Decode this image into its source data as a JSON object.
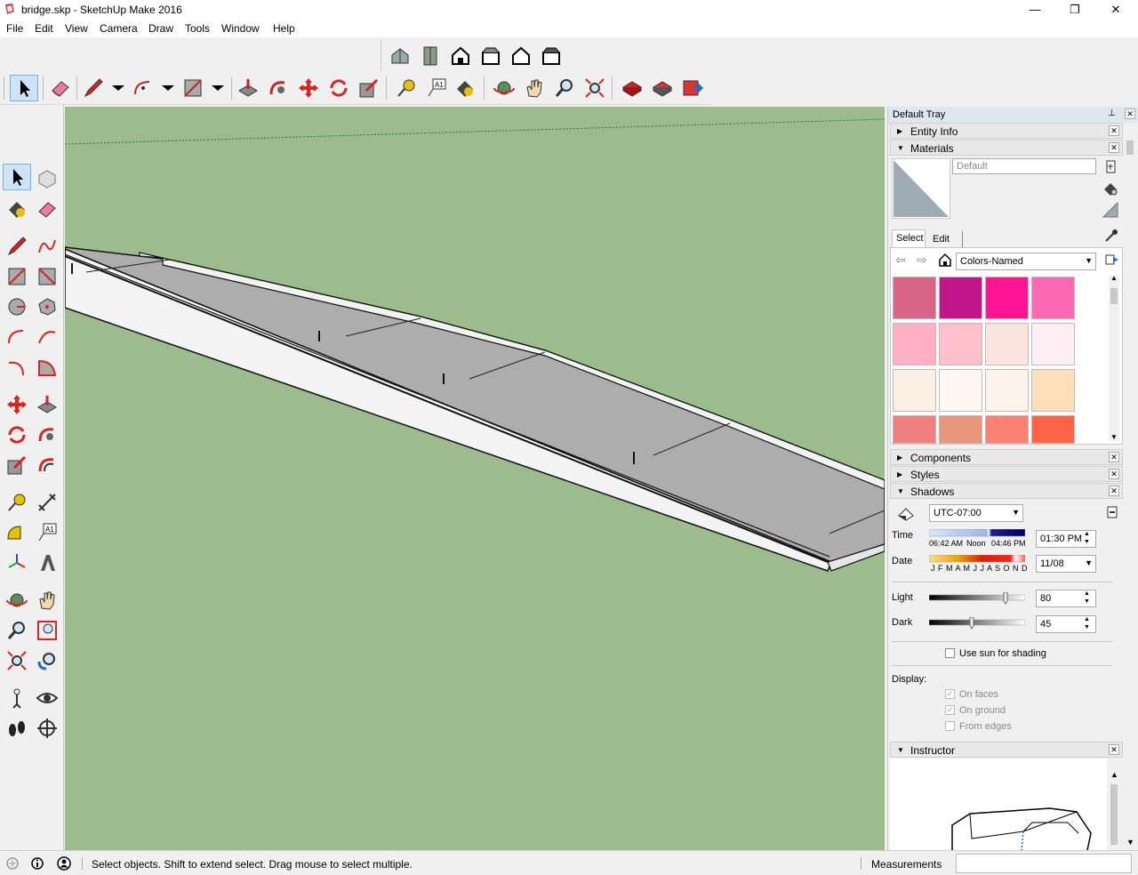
{
  "window": {
    "title": "bridge.skp - SketchUp Make 2016",
    "minimize": "—",
    "maximize": "❐",
    "close": "✕"
  },
  "menu": [
    "File",
    "Edit",
    "View",
    "Camera",
    "Draw",
    "Tools",
    "Window",
    "Help"
  ],
  "tray": {
    "title": "Default Tray",
    "entity_info": "Entity Info",
    "materials": {
      "header": "Materials",
      "name_placeholder": "Default",
      "tab_select": "Select",
      "tab_edit": "Edit",
      "library": "Colors-Named",
      "swatches": [
        "#d9668a",
        "#c0168a",
        "#ff1493",
        "#ff69b4",
        "#ffb0c4",
        "#ffc0cb",
        "#fde3de",
        "#fff0f5",
        "#fbefe3",
        "#fdf8f3",
        "#fdf3ec",
        "#ffdfb9",
        "#f08080",
        "#e9967a",
        "#fa8072",
        "#ff6347"
      ]
    },
    "components": "Components",
    "styles": "Styles",
    "shadows": {
      "header": "Shadows",
      "timezone": "UTC-07:00",
      "time_label": "Time",
      "time_sunrise": "06:42 AM",
      "time_noon": "Noon",
      "time_sunset": "04:46 PM",
      "time_value": "01:30 PM",
      "date_label": "Date",
      "months": "J F M A M J J A S O N D",
      "date_value": "11/08",
      "light_label": "Light",
      "light_value": "80",
      "dark_label": "Dark",
      "dark_value": "45",
      "use_sun": "Use sun for shading",
      "display_label": "Display:",
      "on_faces": "On faces",
      "on_ground": "On ground",
      "from_edges": "From edges"
    },
    "instructor": "Instructor"
  },
  "status": {
    "hint": "Select objects. Shift to extend select. Drag mouse to select multiple.",
    "measurements_label": "Measurements"
  }
}
